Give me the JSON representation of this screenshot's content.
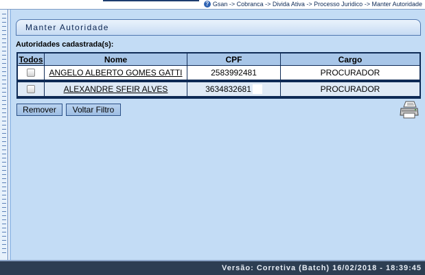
{
  "breadcrumb": {
    "icon": "help-icon",
    "text": "Gsan -> Cobranca -> Divida Ativa -> Processo Juridico -> Manter Autoridade"
  },
  "panel": {
    "title": "Manter Autoridade"
  },
  "section_label": "Autoridades cadastrada(s):",
  "table": {
    "headers": {
      "todos": "Todos",
      "nome": "Nome",
      "cpf": "CPF",
      "cargo": "Cargo"
    },
    "rows": [
      {
        "nome": "ANGELO ALBERTO GOMES GATTI",
        "cpf": "2583992481",
        "cargo": "PROCURADOR",
        "checked": false
      },
      {
        "nome": "ALEXANDRE SFEIR ALVES",
        "cpf": "3634832681",
        "cargo": "PROCURADOR",
        "checked": false
      }
    ]
  },
  "buttons": {
    "remover": "Remover",
    "voltar_filtro": "Voltar Filtro"
  },
  "icons": {
    "print": "printer-icon"
  },
  "footer": {
    "version": "Versão: Corretiva (Batch) 16/02/2018 - 18:39:45"
  },
  "colors": {
    "content_bg": "#c3dcf5",
    "header_cell": "#a8c6e8",
    "footer_bg": "#2d3e52",
    "grid_border": "#0e2a55"
  }
}
